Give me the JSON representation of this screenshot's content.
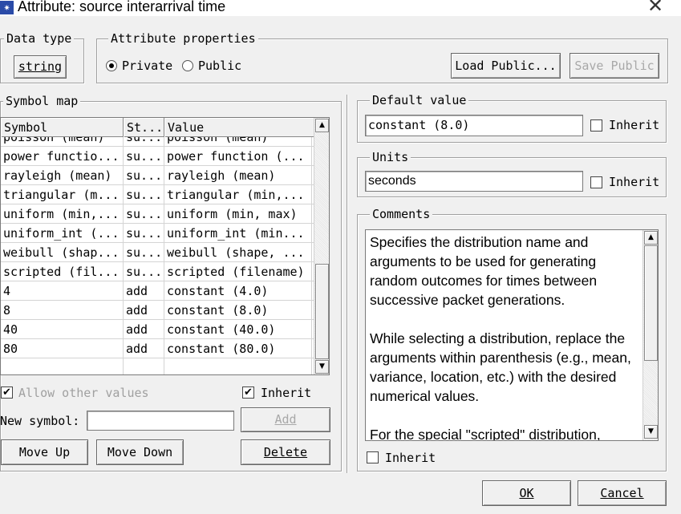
{
  "window": {
    "title": "Attribute: source interarrival time",
    "icon": "app-star-icon",
    "close_glyph": "✕"
  },
  "data_type": {
    "group_label": "Data type",
    "value": "string"
  },
  "attribute_properties": {
    "group_label": "Attribute properties",
    "private_label": "Private",
    "public_label": "Public",
    "selected": "Private",
    "load_public": "Load Public...",
    "save_public": "Save Public"
  },
  "symbol_map": {
    "group_label": "Symbol map",
    "columns": [
      "Symbol",
      "St...",
      "Value"
    ],
    "rows": [
      [
        "poisson (mean)",
        "su...",
        "poisson (mean)"
      ],
      [
        "power functio...",
        "su...",
        "power function (..."
      ],
      [
        "rayleigh (mean)",
        "su...",
        "rayleigh (mean)"
      ],
      [
        "triangular (m...",
        "su...",
        "triangular (min,..."
      ],
      [
        "uniform (min,...",
        "su...",
        "uniform (min, max)"
      ],
      [
        "uniform_int (...",
        "su...",
        "uniform_int (min..."
      ],
      [
        "weibull (shap...",
        "su...",
        "weibull (shape, ..."
      ],
      [
        "scripted (fil...",
        "su...",
        "scripted (filename)"
      ],
      [
        "4",
        "add",
        "constant (4.0)"
      ],
      [
        "8",
        "add",
        "constant (8.0)"
      ],
      [
        "40",
        "add",
        "constant (40.0)"
      ],
      [
        "80",
        "add",
        "constant (80.0)"
      ],
      [
        "",
        "",
        ""
      ]
    ],
    "allow_other_values": "Allow other values",
    "allow_other_checked": true,
    "inherit_label": "Inherit",
    "inherit_checked": true,
    "new_symbol_label": "New symbol:",
    "new_symbol_value": "",
    "add_button": "Add",
    "move_up": "Move Up",
    "move_down": "Move Down",
    "delete": "Delete"
  },
  "default_value": {
    "group_label": "Default value",
    "value": "constant (8.0)",
    "inherit_label": "Inherit",
    "inherit_checked": false
  },
  "units": {
    "group_label": "Units",
    "value": "seconds",
    "inherit_label": "Inherit",
    "inherit_checked": false
  },
  "comments": {
    "group_label": "Comments",
    "paragraphs": [
      "Specifies the distribution name and arguments to be used for generating random outcomes for times between successive packet generations.",
      "While selecting a distribution, replace the arguments within parenthesis (e.g., mean, variance, location, etc.) with the desired numerical values.",
      "For the special \"scripted\" distribution,"
    ],
    "inherit_label": "Inherit",
    "inherit_checked": false
  },
  "footer": {
    "ok": "OK",
    "cancel": "Cancel"
  },
  "colors": {
    "dialog_bg": "#f0f0f0",
    "title_icon_bg": "#2a4ba8"
  }
}
